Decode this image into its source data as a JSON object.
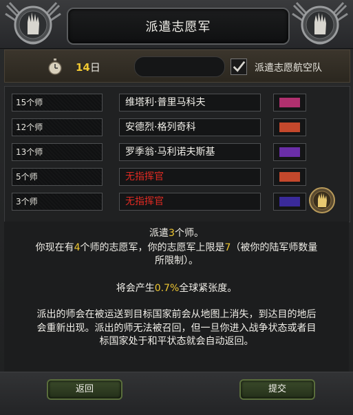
{
  "title": "派遣志愿军",
  "info": {
    "days_value": "14",
    "days_unit": "日",
    "air_checked": true,
    "air_label": "派遣志愿航空队"
  },
  "rows": [
    {
      "count": "15个师",
      "commander": "维塔利·普里马科夫",
      "none": false,
      "color": "#b0306e"
    },
    {
      "count": "12个师",
      "commander": "安德烈·格列奇科",
      "none": false,
      "color": "#c4482c"
    },
    {
      "count": "13个师",
      "commander": "罗季翁·马利诺夫斯基",
      "none": false,
      "color": "#6a2ea8"
    },
    {
      "count": "5个师",
      "commander": "无指挥官",
      "none": true,
      "color": "#c4482c"
    },
    {
      "count": "3个师",
      "commander": "无指挥官",
      "none": true,
      "color": "#3a2a9a"
    }
  ],
  "description": {
    "line1_pre": "派遣",
    "line1_num": "3",
    "line1_post": "个师。",
    "line2_pre": "你现在有",
    "line2_num": "4",
    "line2_mid": "个师的志愿军，你的志愿军上限是",
    "line2_limit": "7",
    "line2_post": "（被你的陆军师数量",
    "line3": "所限制）。",
    "line4_pre": "将会产生",
    "line4_num": "0.7%",
    "line4_post": "全球紧张度。",
    "line5": "派出的师会在被运送到目标国家前会从地图上消失，到达目的地后",
    "line6": "会重新出现。派出的师无法被召回，但一旦你进入战争状态或者目",
    "line7": "标国家处于和平状态就会自动返回。"
  },
  "buttons": {
    "back": "返回",
    "submit": "提交"
  }
}
